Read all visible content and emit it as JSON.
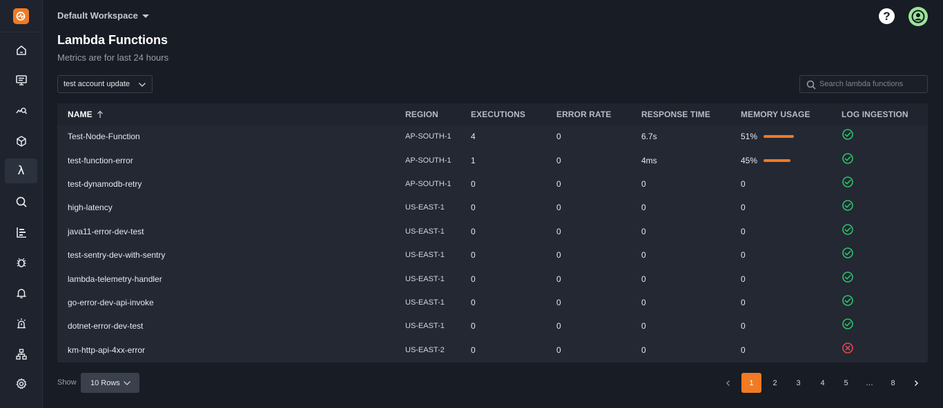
{
  "header": {
    "workspace": "Default Workspace",
    "title": "Lambda Functions",
    "subtitle": "Metrics are for last 24 hours",
    "help_glyph": "?"
  },
  "sidebar": {
    "logo_icon": "logo-icon",
    "items": [
      {
        "icon": "home-icon"
      },
      {
        "icon": "monitor-icon"
      },
      {
        "icon": "analytics-search-icon"
      },
      {
        "icon": "cube-icon"
      },
      {
        "icon": "lambda-icon",
        "glyph": "λ",
        "active": true
      },
      {
        "icon": "search-icon"
      },
      {
        "icon": "chart-bars-icon"
      },
      {
        "icon": "bug-icon"
      },
      {
        "icon": "bell-icon"
      },
      {
        "icon": "alarm-icon"
      },
      {
        "icon": "sitemap-icon"
      },
      {
        "icon": "gear-icon"
      }
    ]
  },
  "filters": {
    "account": "test account update",
    "search_placeholder": "Search lambda functions"
  },
  "table": {
    "columns": [
      "NAME",
      "REGION",
      "EXECUTIONS",
      "ERROR RATE",
      "RESPONSE TIME",
      "MEMORY USAGE",
      "LOG INGESTION"
    ],
    "rows": [
      {
        "name": "Test-Node-Function",
        "region": "AP-SOUTH-1",
        "executions": "4",
        "error_rate": "0",
        "response_time": "6.7s",
        "memory": "51%",
        "memory_fraction": 0.51,
        "log_ok": true
      },
      {
        "name": "test-function-error",
        "region": "AP-SOUTH-1",
        "executions": "1",
        "error_rate": "0",
        "response_time": "4ms",
        "memory": "45%",
        "memory_fraction": 0.45,
        "log_ok": true
      },
      {
        "name": "test-dynamodb-retry",
        "region": "AP-SOUTH-1",
        "executions": "0",
        "error_rate": "0",
        "response_time": "0",
        "memory": "0",
        "log_ok": true
      },
      {
        "name": "high-latency",
        "region": "US-EAST-1",
        "executions": "0",
        "error_rate": "0",
        "response_time": "0",
        "memory": "0",
        "log_ok": true
      },
      {
        "name": "java11-error-dev-test",
        "region": "US-EAST-1",
        "executions": "0",
        "error_rate": "0",
        "response_time": "0",
        "memory": "0",
        "log_ok": true
      },
      {
        "name": "test-sentry-dev-with-sentry",
        "region": "US-EAST-1",
        "executions": "0",
        "error_rate": "0",
        "response_time": "0",
        "memory": "0",
        "log_ok": true
      },
      {
        "name": "lambda-telemetry-handler",
        "region": "US-EAST-1",
        "executions": "0",
        "error_rate": "0",
        "response_time": "0",
        "memory": "0",
        "log_ok": true
      },
      {
        "name": "go-error-dev-api-invoke",
        "region": "US-EAST-1",
        "executions": "0",
        "error_rate": "0",
        "response_time": "0",
        "memory": "0",
        "log_ok": true
      },
      {
        "name": "dotnet-error-dev-test",
        "region": "US-EAST-1",
        "executions": "0",
        "error_rate": "0",
        "response_time": "0",
        "memory": "0",
        "log_ok": true
      },
      {
        "name": "km-http-api-4xx-error",
        "region": "US-EAST-2",
        "executions": "0",
        "error_rate": "0",
        "response_time": "0",
        "memory": "0",
        "log_ok": false
      }
    ]
  },
  "footer": {
    "show_label": "Show",
    "rows_per_page": "10 Rows",
    "pages": [
      "1",
      "2",
      "3",
      "4",
      "5",
      "…",
      "8"
    ],
    "current_page": "1"
  },
  "colors": {
    "accent": "#f07a25",
    "success": "#2ec26b",
    "error": "#e5484d",
    "background": "#181c24",
    "avatar": "#9be39a"
  }
}
